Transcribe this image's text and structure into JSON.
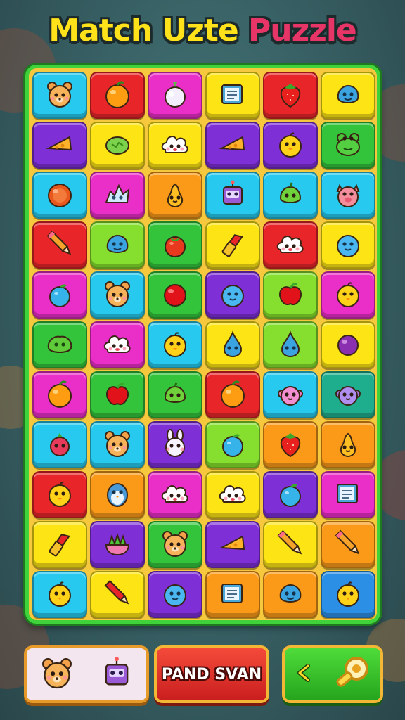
{
  "title": {
    "part1": "Match Uzte",
    "part2": "Puzzle"
  },
  "colors": {
    "cyan": "#27c9ee",
    "red": "#e8262a",
    "magenta": "#ea2fc8",
    "yellow": "#fde515",
    "purple": "#7e2fd6",
    "orange": "#fb9a19",
    "green": "#33c43b",
    "lime": "#86df2e",
    "teal": "#1fae8d",
    "blue": "#2c8fe6",
    "pink": "#f05aa5"
  },
  "grid": [
    [
      {
        "bg": "cyan",
        "icon": "bear-icon"
      },
      {
        "bg": "red",
        "icon": "orange-icon"
      },
      {
        "bg": "magenta",
        "icon": "onion-icon"
      },
      {
        "bg": "yellow",
        "icon": "book-icon"
      },
      {
        "bg": "red",
        "icon": "strawberry-icon"
      },
      {
        "bg": "yellow",
        "icon": "blue-blob-icon"
      }
    ],
    [
      {
        "bg": "purple",
        "icon": "cheese-icon"
      },
      {
        "bg": "yellow",
        "icon": "melon-icon"
      },
      {
        "bg": "yellow",
        "icon": "cloud-icon"
      },
      {
        "bg": "purple",
        "icon": "cheese-icon"
      },
      {
        "bg": "purple",
        "icon": "chick-icon"
      },
      {
        "bg": "green",
        "icon": "frog-icon"
      }
    ],
    [
      {
        "bg": "cyan",
        "icon": "orange-ball-icon"
      },
      {
        "bg": "magenta",
        "icon": "ice-icon"
      },
      {
        "bg": "orange",
        "icon": "pear-icon"
      },
      {
        "bg": "cyan",
        "icon": "robot-icon"
      },
      {
        "bg": "cyan",
        "icon": "lime-icon"
      },
      {
        "bg": "cyan",
        "icon": "pig-icon"
      }
    ],
    [
      {
        "bg": "red",
        "icon": "pencil-icon"
      },
      {
        "bg": "lime",
        "icon": "blue-blob-icon"
      },
      {
        "bg": "green",
        "icon": "tomato-icon"
      },
      {
        "bg": "yellow",
        "icon": "lipstick-icon"
      },
      {
        "bg": "red",
        "icon": "cloud-icon"
      },
      {
        "bg": "yellow",
        "icon": "blue-creature-icon"
      }
    ],
    [
      {
        "bg": "magenta",
        "icon": "blue-apple-icon"
      },
      {
        "bg": "cyan",
        "icon": "bear-icon"
      },
      {
        "bg": "green",
        "icon": "red-ball-icon"
      },
      {
        "bg": "purple",
        "icon": "blue-creature-icon"
      },
      {
        "bg": "lime",
        "icon": "apple-icon"
      },
      {
        "bg": "magenta",
        "icon": "chick-icon"
      }
    ],
    [
      {
        "bg": "green",
        "icon": "green-blob-icon"
      },
      {
        "bg": "magenta",
        "icon": "cloud-icon"
      },
      {
        "bg": "cyan",
        "icon": "chick-icon"
      },
      {
        "bg": "yellow",
        "icon": "drop-icon"
      },
      {
        "bg": "lime",
        "icon": "drop-icon"
      },
      {
        "bg": "yellow",
        "icon": "grape-icon"
      }
    ],
    [
      {
        "bg": "magenta",
        "icon": "orange-icon"
      },
      {
        "bg": "green",
        "icon": "apple-icon"
      },
      {
        "bg": "green",
        "icon": "lime-icon"
      },
      {
        "bg": "red",
        "icon": "orange-icon"
      },
      {
        "bg": "cyan",
        "icon": "pink-creature-icon"
      },
      {
        "bg": "teal",
        "icon": "purple-creature-icon"
      }
    ],
    [
      {
        "bg": "cyan",
        "icon": "radish-icon"
      },
      {
        "bg": "cyan",
        "icon": "bear-icon"
      },
      {
        "bg": "purple",
        "icon": "bunny-icon"
      },
      {
        "bg": "lime",
        "icon": "blue-apple-icon"
      },
      {
        "bg": "orange",
        "icon": "strawberry-icon"
      },
      {
        "bg": "orange",
        "icon": "pear-icon"
      }
    ],
    [
      {
        "bg": "red",
        "icon": "chick-icon"
      },
      {
        "bg": "orange",
        "icon": "penguin-icon"
      },
      {
        "bg": "magenta",
        "icon": "cloud-icon"
      },
      {
        "bg": "yellow",
        "icon": "cloud-icon"
      },
      {
        "bg": "purple",
        "icon": "blue-apple-icon"
      },
      {
        "bg": "magenta",
        "icon": "book-icon"
      }
    ],
    [
      {
        "bg": "yellow",
        "icon": "lipstick-icon"
      },
      {
        "bg": "purple",
        "icon": "salad-icon"
      },
      {
        "bg": "green",
        "icon": "bear-icon"
      },
      {
        "bg": "purple",
        "icon": "cheese-icon"
      },
      {
        "bg": "yellow",
        "icon": "pencil-icon"
      },
      {
        "bg": "orange",
        "icon": "pencil-icon"
      }
    ],
    [
      {
        "bg": "cyan",
        "icon": "chick-icon"
      },
      {
        "bg": "yellow",
        "icon": "red-pencil-icon"
      },
      {
        "bg": "purple",
        "icon": "blue-creature-icon"
      },
      {
        "bg": "orange",
        "icon": "book-icon"
      },
      {
        "bg": "orange",
        "icon": "blue-blob-icon"
      },
      {
        "bg": "blue",
        "icon": "chick-icon"
      }
    ]
  ],
  "bottom": {
    "left_icons": [
      "bear-icon",
      "robot-icon"
    ],
    "red_button_label": "PAND SVAN",
    "green_button_icons": [
      "chevron-left-icon",
      "key-icon"
    ]
  }
}
